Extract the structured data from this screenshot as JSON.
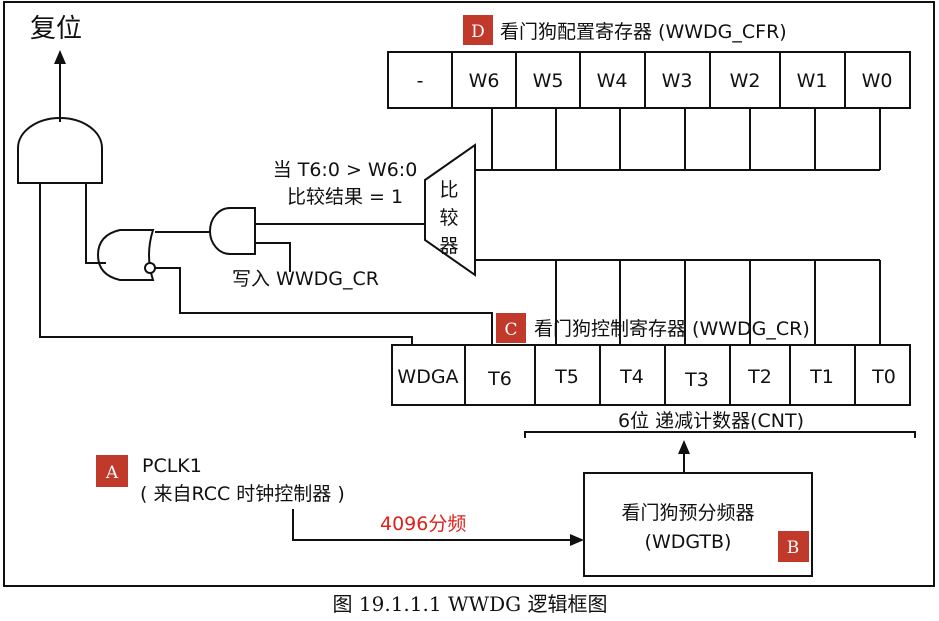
{
  "reset_label": "复位",
  "cfr": {
    "tag": "D",
    "title": "看门狗配置寄存器 (WWDG_CFR)",
    "cells": [
      "-",
      "W6",
      "W5",
      "W4",
      "W3",
      "W2",
      "W1",
      "W0"
    ]
  },
  "cr": {
    "tag": "C",
    "title": "看门狗控制寄存器 (WWDG_CR)",
    "cells": [
      "WDGA",
      "T6",
      "T5",
      "T4",
      "T3",
      "T2",
      "T1",
      "T0"
    ]
  },
  "counter_label": "6位 递减计数器(CNT)",
  "comparator": {
    "chars": [
      "比",
      "较",
      "器"
    ]
  },
  "condition": {
    "line1": "当 T6:0 > W6:0",
    "line2": "比较结果 = 1"
  },
  "write_label": "写入 WWDG_CR",
  "pclk": {
    "tag": "A",
    "line1": "PCLK1",
    "line2": "( 来自RCC 时钟控制器 )",
    "freq_label": "4096分频"
  },
  "prescaler": {
    "tag": "B",
    "line1": "看门狗预分频器",
    "line2": "(WDGTB)"
  },
  "caption": "图 19.1.1.1 WWDG 逻辑框图",
  "colors": {
    "tag_bg": "#c0392b",
    "freq_text": "#e0201a",
    "stroke": "#111111"
  }
}
